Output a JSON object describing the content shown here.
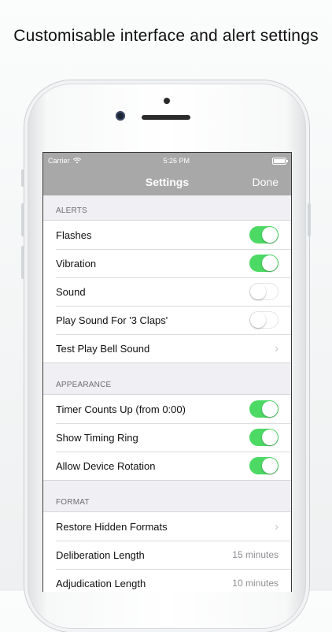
{
  "headline": "Customisable interface and alert settings",
  "status_bar": {
    "carrier": "Carrier",
    "time": "5:26 PM"
  },
  "nav": {
    "title": "Settings",
    "done_label": "Done"
  },
  "colors": {
    "toggle_on": "#4cd964",
    "nav_bg": "#a8a8a8"
  },
  "sections": [
    {
      "header": "ALERTS",
      "rows": [
        {
          "label": "Flashes",
          "control": "toggle",
          "on": true
        },
        {
          "label": "Vibration",
          "control": "toggle",
          "on": true
        },
        {
          "label": "Sound",
          "control": "toggle",
          "on": false
        },
        {
          "label": "Play Sound For '3 Claps'",
          "control": "toggle",
          "on": false
        },
        {
          "label": "Test Play Bell Sound",
          "control": "chevron"
        }
      ]
    },
    {
      "header": "APPEARANCE",
      "rows": [
        {
          "label": "Timer Counts Up (from 0:00)",
          "control": "toggle",
          "on": true
        },
        {
          "label": "Show Timing Ring",
          "control": "toggle",
          "on": true
        },
        {
          "label": "Allow Device Rotation",
          "control": "toggle",
          "on": true
        }
      ]
    },
    {
      "header": "FORMAT",
      "rows": [
        {
          "label": "Restore Hidden Formats",
          "control": "chevron"
        },
        {
          "label": "Deliberation Length",
          "control": "detail",
          "value": "15 minutes"
        },
        {
          "label": "Adjudication Length",
          "control": "detail",
          "value": "10 minutes"
        }
      ]
    }
  ]
}
